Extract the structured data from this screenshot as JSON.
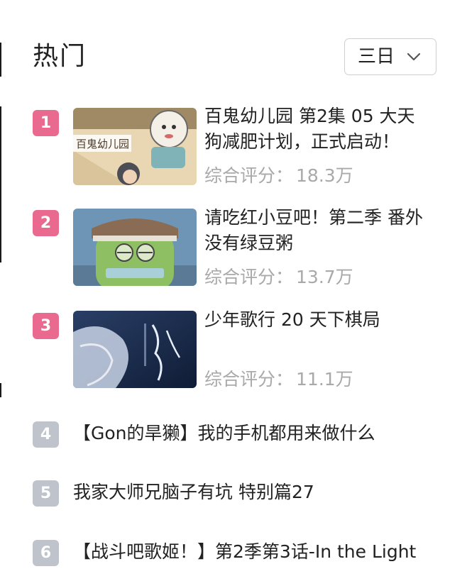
{
  "header": {
    "title": "热门",
    "range_select": {
      "value": "三日"
    }
  },
  "rich_items": [
    {
      "rank": "1",
      "title_line1": "百鬼幼儿园 第2集 05 大天",
      "title_line2": "狗减肥计划，正式启动！",
      "score_label": "综合评分：",
      "score_value": "18.3万",
      "thumb_text": "百鬼幼儿园"
    },
    {
      "rank": "2",
      "title_line1": "请吃红小豆吧！第二季 番外",
      "title_line2": "没有绿豆粥",
      "score_label": "综合评分：",
      "score_value": "13.7万"
    },
    {
      "rank": "3",
      "title_line1": "少年歌行 20 天下棋局",
      "title_line2": "",
      "score_label": "综合评分：",
      "score_value": "11.1万"
    }
  ],
  "plain_items": [
    {
      "rank": "4",
      "title": "【Gon的旱獭】我的手机都用来做什么"
    },
    {
      "rank": "5",
      "title": "我家大师兄脑子有坑 特别篇27"
    },
    {
      "rank": "6",
      "title": "【战斗吧歌姬！】第2季第3话-In the Light"
    }
  ],
  "colors": {
    "rank_top": "#e96a8e",
    "rank_rest": "#bfc4cc",
    "score_text": "#a9a9a9"
  }
}
